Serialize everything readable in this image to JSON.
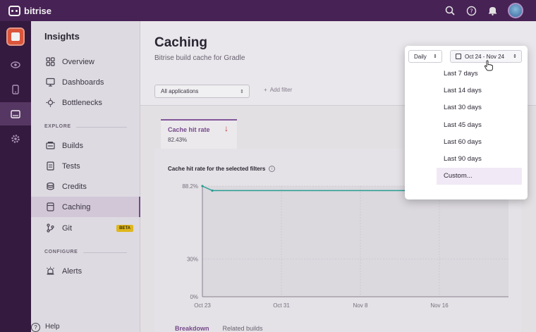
{
  "topbar": {
    "brand": "bitrise",
    "icons": [
      "search-icon",
      "help-icon",
      "bell-icon",
      "avatar"
    ]
  },
  "rail": {
    "icons": [
      "app-icon",
      "eye-icon",
      "phone-icon",
      "insights-icon",
      "settings-icon"
    ],
    "active": "insights-icon"
  },
  "sidebar": {
    "title": "Insights",
    "items": [
      {
        "label": "Overview",
        "icon": "overview-icon"
      },
      {
        "label": "Dashboards",
        "icon": "dashboards-icon"
      },
      {
        "label": "Bottlenecks",
        "icon": "bottlenecks-icon"
      }
    ],
    "explore_label": "EXPLORE",
    "explore_items": [
      {
        "label": "Builds",
        "icon": "builds-icon"
      },
      {
        "label": "Tests",
        "icon": "tests-icon"
      },
      {
        "label": "Credits",
        "icon": "credits-icon"
      },
      {
        "label": "Caching",
        "icon": "caching-icon",
        "active": true
      },
      {
        "label": "Git",
        "icon": "git-icon",
        "badge": "BETA"
      }
    ],
    "configure_label": "CONFIGURE",
    "configure_items": [
      {
        "label": "Alerts",
        "icon": "alerts-icon"
      }
    ],
    "help_label": "Help"
  },
  "main": {
    "title": "Caching",
    "subtitle": "Bitrise build cache for Gradle",
    "app_filter": "All applications",
    "add_filter": "Add filter",
    "metric_tab": {
      "label": "Cache hit rate",
      "value": "82.43%"
    },
    "chart_title": "Cache hit rate for the selected filters",
    "bottom_tabs": [
      "Breakdown",
      "Related builds"
    ]
  },
  "popover": {
    "granularity": "Daily",
    "date_range": "Oct 24 - Nov 24",
    "options": [
      "Last 7 days",
      "Last 14 days",
      "Last 30 days",
      "Last 45 days",
      "Last 60 days",
      "Last 90 days",
      "Custom..."
    ],
    "highlighted": "Custom..."
  },
  "chart_data": {
    "type": "line",
    "title": "Cache hit rate for the selected filters",
    "ylim": [
      0,
      100
    ],
    "y_ticks": [
      "0%",
      "30%",
      "88.2%"
    ],
    "x_ticks": [
      "Oct 23",
      "Oct 31",
      "Nov 8",
      "Nov 16"
    ],
    "series": [
      {
        "color": "#2aa79b",
        "x": [
          "Oct 23",
          "Oct 24",
          "Nov 13",
          "Nov 14",
          "Nov 15",
          "Nov 16",
          "Nov 17",
          "Nov 19",
          "Nov 20"
        ],
        "values": [
          88.2,
          84.6,
          84.6,
          82.0,
          80.5,
          79.4,
          79.0,
          78.6,
          78.4
        ]
      }
    ],
    "grid": true
  }
}
